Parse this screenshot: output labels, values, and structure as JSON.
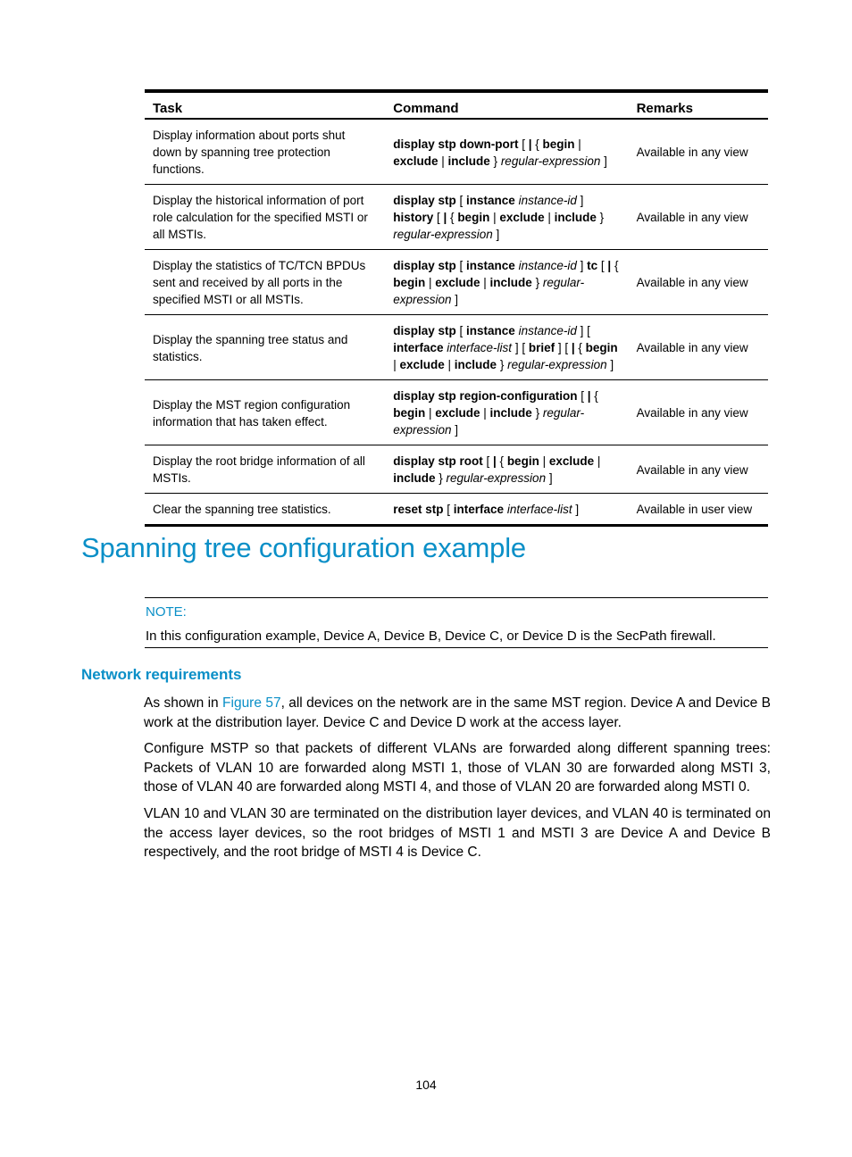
{
  "table": {
    "headers": {
      "task": "Task",
      "command": "Command",
      "remarks": "Remarks"
    },
    "rows": [
      {
        "task": "Display information about ports shut down by spanning tree protection functions.",
        "command": [
          {
            "t": "b",
            "v": "display stp down-port"
          },
          {
            "t": "n",
            "v": " [ "
          },
          {
            "t": "b",
            "v": "|"
          },
          {
            "t": "n",
            "v": " { "
          },
          {
            "t": "b",
            "v": "begin"
          },
          {
            "t": "n",
            "v": " | "
          },
          {
            "t": "b",
            "v": "exclude"
          },
          {
            "t": "n",
            "v": " | "
          },
          {
            "t": "b",
            "v": "include"
          },
          {
            "t": "n",
            "v": " } "
          },
          {
            "t": "i",
            "v": "regular-expression"
          },
          {
            "t": "n",
            "v": " ]"
          }
        ],
        "remarks": "Available in any view"
      },
      {
        "task": "Display the historical information of port role calculation for the specified MSTI or all MSTIs.",
        "command": [
          {
            "t": "b",
            "v": "display stp"
          },
          {
            "t": "n",
            "v": " [ "
          },
          {
            "t": "b",
            "v": "instance"
          },
          {
            "t": "n",
            "v": " "
          },
          {
            "t": "i",
            "v": "instance-id"
          },
          {
            "t": "n",
            "v": " ] "
          },
          {
            "t": "b",
            "v": "history"
          },
          {
            "t": "n",
            "v": " [ "
          },
          {
            "t": "b",
            "v": "|"
          },
          {
            "t": "n",
            "v": " { "
          },
          {
            "t": "b",
            "v": "begin"
          },
          {
            "t": "n",
            "v": " | "
          },
          {
            "t": "b",
            "v": "exclude"
          },
          {
            "t": "n",
            "v": " | "
          },
          {
            "t": "b",
            "v": "include"
          },
          {
            "t": "n",
            "v": " } "
          },
          {
            "t": "i",
            "v": "regular-expression"
          },
          {
            "t": "n",
            "v": " ]"
          }
        ],
        "remarks": "Available in any view"
      },
      {
        "task": "Display the statistics of TC/TCN BPDUs sent and received by all ports in the specified MSTI or all MSTIs.",
        "command": [
          {
            "t": "b",
            "v": "display stp"
          },
          {
            "t": "n",
            "v": " [ "
          },
          {
            "t": "b",
            "v": "instance"
          },
          {
            "t": "n",
            "v": " "
          },
          {
            "t": "i",
            "v": "instance-id"
          },
          {
            "t": "n",
            "v": " ] "
          },
          {
            "t": "b",
            "v": "tc"
          },
          {
            "t": "n",
            "v": " [ "
          },
          {
            "t": "b",
            "v": "|"
          },
          {
            "t": "n",
            "v": " { "
          },
          {
            "t": "b",
            "v": "begin"
          },
          {
            "t": "n",
            "v": " | "
          },
          {
            "t": "b",
            "v": "exclude"
          },
          {
            "t": "n",
            "v": " | "
          },
          {
            "t": "b",
            "v": "include"
          },
          {
            "t": "n",
            "v": " } "
          },
          {
            "t": "i",
            "v": "regular-expression"
          },
          {
            "t": "n",
            "v": " ]"
          }
        ],
        "remarks": "Available in any view"
      },
      {
        "task": "Display the spanning tree status and statistics.",
        "command": [
          {
            "t": "b",
            "v": "display stp"
          },
          {
            "t": "n",
            "v": " [ "
          },
          {
            "t": "b",
            "v": "instance"
          },
          {
            "t": "n",
            "v": " "
          },
          {
            "t": "i",
            "v": "instance-id"
          },
          {
            "t": "n",
            "v": " ] "
          },
          {
            "t": "n",
            "v": "[ "
          },
          {
            "t": "b",
            "v": "interface"
          },
          {
            "t": "n",
            "v": " "
          },
          {
            "t": "i",
            "v": "interface-list"
          },
          {
            "t": "n",
            "v": " ] [ "
          },
          {
            "t": "b",
            "v": "brief"
          },
          {
            "t": "n",
            "v": " ] [ "
          },
          {
            "t": "b",
            "v": "|"
          },
          {
            "t": "n",
            "v": " { "
          },
          {
            "t": "b",
            "v": "begin"
          },
          {
            "t": "n",
            "v": " | "
          },
          {
            "t": "b",
            "v": "exclude"
          },
          {
            "t": "n",
            "v": " | "
          },
          {
            "t": "b",
            "v": "include"
          },
          {
            "t": "n",
            "v": " } "
          },
          {
            "t": "i",
            "v": "regular-expression"
          },
          {
            "t": "n",
            "v": " ]"
          }
        ],
        "remarks": "Available in any view"
      },
      {
        "task": "Display the MST region configuration information that has taken effect.",
        "command": [
          {
            "t": "b",
            "v": "display stp region-configuration"
          },
          {
            "t": "n",
            "v": " [ "
          },
          {
            "t": "b",
            "v": "|"
          },
          {
            "t": "n",
            "v": " { "
          },
          {
            "t": "b",
            "v": "begin"
          },
          {
            "t": "n",
            "v": " | "
          },
          {
            "t": "b",
            "v": "exclude"
          },
          {
            "t": "n",
            "v": " | "
          },
          {
            "t": "b",
            "v": "include"
          },
          {
            "t": "n",
            "v": " } "
          },
          {
            "t": "i",
            "v": "regular-expression"
          },
          {
            "t": "n",
            "v": " ]"
          }
        ],
        "remarks": "Available in any view"
      },
      {
        "task": "Display the root bridge information of all MSTIs.",
        "command": [
          {
            "t": "b",
            "v": "display stp root"
          },
          {
            "t": "n",
            "v": " [ "
          },
          {
            "t": "b",
            "v": "|"
          },
          {
            "t": "n",
            "v": " { "
          },
          {
            "t": "b",
            "v": "begin"
          },
          {
            "t": "n",
            "v": " | "
          },
          {
            "t": "b",
            "v": "exclude"
          },
          {
            "t": "n",
            "v": " | "
          },
          {
            "t": "b",
            "v": "include"
          },
          {
            "t": "n",
            "v": " } "
          },
          {
            "t": "i",
            "v": "regular-expression"
          },
          {
            "t": "n",
            "v": " ]"
          }
        ],
        "remarks": "Available in any view"
      },
      {
        "task": "Clear the spanning tree statistics.",
        "command": [
          {
            "t": "b",
            "v": "reset stp"
          },
          {
            "t": "n",
            "v": " [ "
          },
          {
            "t": "b",
            "v": "interface"
          },
          {
            "t": "n",
            "v": " "
          },
          {
            "t": "i",
            "v": "interface-list"
          },
          {
            "t": "n",
            "v": " ]"
          }
        ],
        "remarks": "Available in user view"
      }
    ]
  },
  "section_title": "Spanning tree configuration example",
  "note": {
    "label": "NOTE:",
    "text": "In this configuration example, Device A, Device B, Device C, or Device D is the SecPath firewall."
  },
  "subsection_title": "Network requirements",
  "paragraphs": {
    "p1_before_link": "As shown in ",
    "p1_link": "Figure 57",
    "p1_after_link": ", all devices on the network are in the same MST region. Device A and Device B work at the distribution layer. Device C and Device D work at the access layer.",
    "p2": "Configure MSTP so that packets of different VLANs are forwarded along different spanning trees: Packets of VLAN 10 are forwarded along MSTI 1, those of VLAN 30 are forwarded along MSTI 3, those of VLAN 40 are forwarded along MSTI 4, and those of VLAN 20 are forwarded along MSTI 0.",
    "p3": "VLAN 10 and VLAN 30 are terminated on the distribution layer devices, and VLAN 40 is terminated on the access layer devices, so the root bridges of MSTI 1 and MSTI 3 are Device A and Device B respectively, and the root bridge of MSTI 4 is Device C."
  },
  "page_number": "104",
  "colors": {
    "accent": "#0a8fc7",
    "text": "#000000"
  }
}
